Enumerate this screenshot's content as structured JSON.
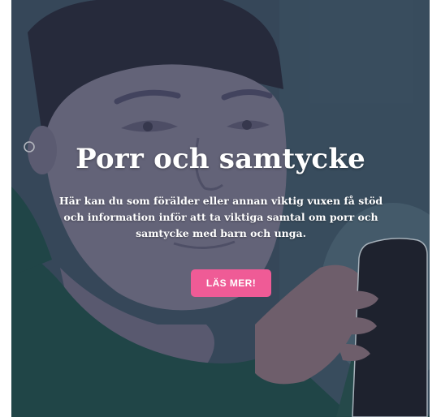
{
  "hero": {
    "title": "Porr och samtycke",
    "description": "Här kan du som förälder eller annan viktig vuxen få stöd och information inför att ta viktiga samtal om porr och samtycke med barn och unga.",
    "cta_label": "LÄS MER!"
  },
  "colors": {
    "background": "#3b4f61",
    "skin": "#7d7890",
    "hair": "#27283a",
    "shirt": "#1f4f4b",
    "button": "#ef5b96"
  },
  "icons": {
    "illustration": "person-with-phone-illustration"
  }
}
